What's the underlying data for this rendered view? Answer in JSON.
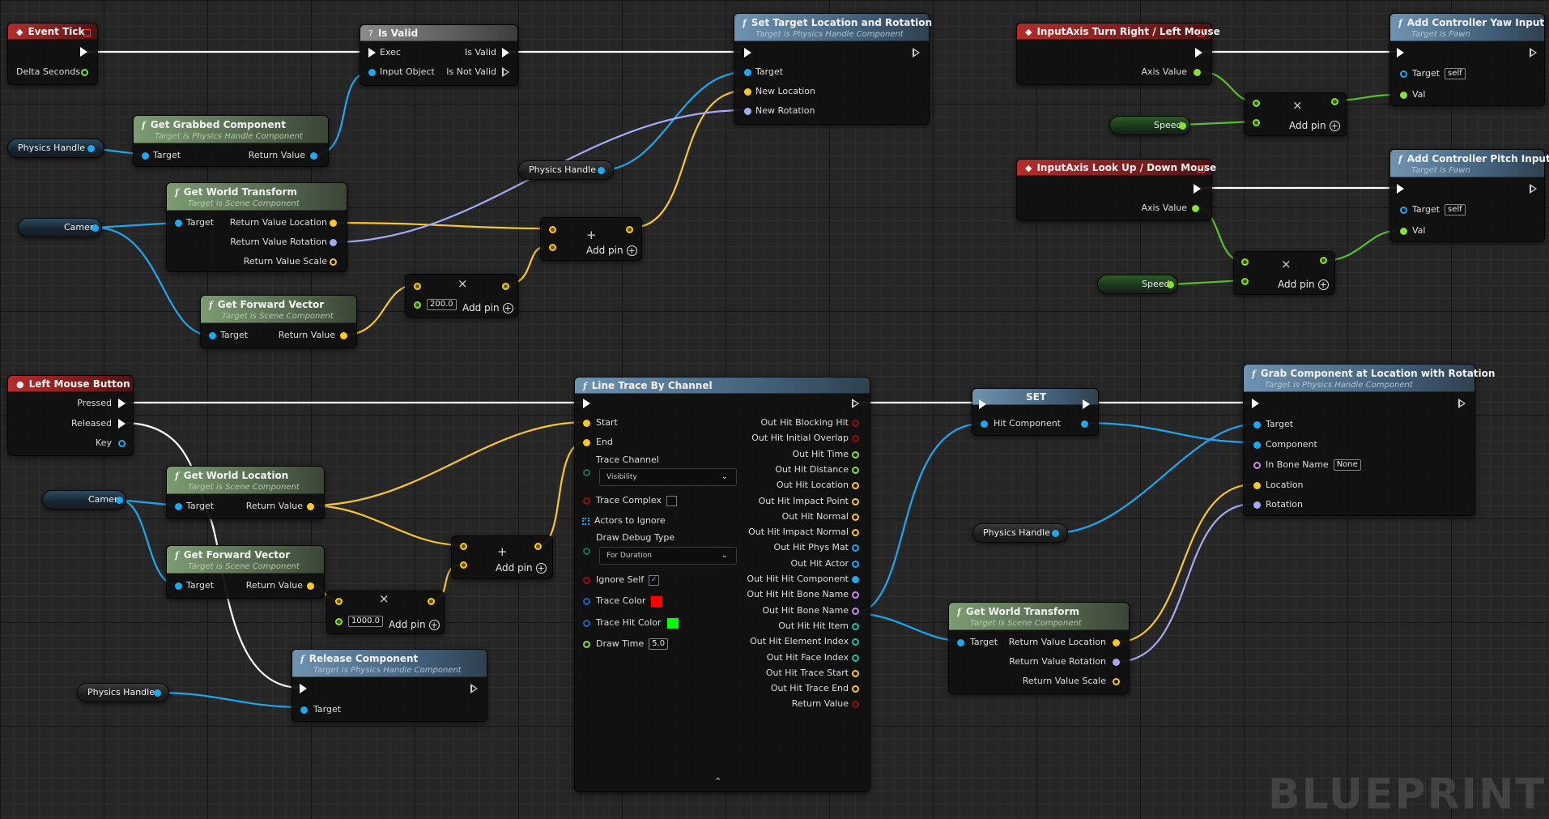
{
  "colors": {
    "exec": "#ffffff",
    "object": "#1da8f0",
    "float": "#8cdc37",
    "vector": "#f7c72c",
    "rotator": "#a5aaf5",
    "transform": "#f0b000",
    "name": "#c78ae8",
    "bool": "#9a0c0c",
    "struct": "#1d8fa0",
    "linear_color": "#1d63c4",
    "teal_out": "#1cbfa0"
  },
  "nodes": {
    "event_tick": {
      "title": "Event Tick",
      "delta": "Delta Seconds"
    },
    "is_valid": {
      "title": "Is Valid",
      "exec": "Exec",
      "is_valid": "Is Valid",
      "input_object": "Input Object",
      "is_not_valid": "Is Not Valid"
    },
    "set_target": {
      "title": "Set Target Location and Rotation",
      "subtitle": "Target is Physics Handle Component",
      "target": "Target",
      "new_location": "New Location",
      "new_rotation": "New Rotation"
    },
    "get_grabbed": {
      "title": "Get Grabbed Component",
      "subtitle": "Target is Physics Handle Component",
      "target": "Target",
      "ret": "Return Value"
    },
    "get_world_transform_1": {
      "title": "Get World Transform",
      "subtitle": "Target is Scene Component",
      "target": "Target",
      "rvl": "Return Value Location",
      "rvr": "Return Value Rotation",
      "rvs": "Return Value Scale"
    },
    "get_forward_1": {
      "title": "Get Forward Vector",
      "subtitle": "Target is Scene Component",
      "target": "Target",
      "ret": "Return Value"
    },
    "mult_1": {
      "value": "200.0",
      "add_pin": "Add pin"
    },
    "add_1": {
      "add_pin": "Add pin"
    },
    "turn_right": {
      "title": "InputAxis Turn Right / Left Mouse",
      "axis": "Axis Value"
    },
    "yaw": {
      "title": "Add Controller Yaw Input",
      "subtitle": "Target is Pawn",
      "target": "Target",
      "self": "self",
      "val": "Val"
    },
    "mult_yaw": {
      "add_pin": "Add pin"
    },
    "look_up": {
      "title": "InputAxis Look Up / Down Mouse",
      "axis": "Axis Value"
    },
    "pitch": {
      "title": "Add Controller Pitch Input",
      "subtitle": "Target is Pawn",
      "target": "Target",
      "self": "self",
      "val": "Val"
    },
    "mult_pitch": {
      "add_pin": "Add pin"
    },
    "lmb": {
      "title": "Left Mouse Button",
      "pressed": "Pressed",
      "released": "Released",
      "key": "Key"
    },
    "get_world_location": {
      "title": "Get World Location",
      "subtitle": "Target is Scene Component",
      "target": "Target",
      "ret": "Return Value"
    },
    "get_forward_2": {
      "title": "Get Forward Vector",
      "subtitle": "Target is Scene Component",
      "target": "Target",
      "ret": "Return Value"
    },
    "mult_2": {
      "value": "1000.0",
      "add_pin": "Add pin"
    },
    "add_2": {
      "add_pin": "Add pin"
    },
    "release": {
      "title": "Release Component",
      "subtitle": "Target is Physics Handle Component",
      "target": "Target"
    },
    "line_trace": {
      "title": "Line Trace By Channel",
      "start": "Start",
      "end": "End",
      "trace_channel": "Trace Channel",
      "trace_channel_value": "Visibility",
      "trace_complex": "Trace Complex",
      "actors_to_ignore": "Actors to Ignore",
      "draw_debug_type": "Draw Debug Type",
      "draw_debug_value": "For Duration",
      "ignore_self": "Ignore Self",
      "trace_color": "Trace Color",
      "trace_hit_color": "Trace Hit Color",
      "draw_time": "Draw Time",
      "draw_time_value": "5.0",
      "trace_color_hex": "#ff0000",
      "trace_hit_color_hex": "#00ff00",
      "outputs": [
        "Out Hit Blocking Hit",
        "Out Hit Initial Overlap",
        "Out Hit Time",
        "Out Hit Distance",
        "Out Hit Location",
        "Out Hit Impact Point",
        "Out Hit Normal",
        "Out Hit Impact Normal",
        "Out Hit Phys Mat",
        "Out Hit Actor",
        "Out Hit Hit Component",
        "Out Hit Hit Bone Name",
        "Out Hit Bone Name",
        "Out Hit Hit Item",
        "Out Hit Element Index",
        "Out Hit Face Index",
        "Out Hit Trace Start",
        "Out Hit Trace End",
        "Return Value"
      ]
    },
    "set_node": {
      "title": "SET",
      "hit_component": "Hit Component"
    },
    "grab": {
      "title": "Grab Component at Location with Rotation",
      "subtitle": "Target is Physics Handle Component",
      "target": "Target",
      "component": "Component",
      "bone": "In Bone Name",
      "bone_value": "None",
      "location": "Location",
      "rotation": "Rotation"
    },
    "get_world_transform_2": {
      "title": "Get World Transform",
      "subtitle": "Target is Scene Component",
      "target": "Target",
      "rvl": "Return Value Location",
      "rvr": "Return Value Rotation",
      "rvs": "Return Value Scale"
    }
  },
  "variables": {
    "physics_handle": "Physics Handle",
    "camera": "Camera",
    "speed": "Speed"
  },
  "watermark": "BLUEPRINT"
}
